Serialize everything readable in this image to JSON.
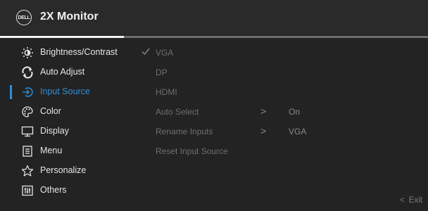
{
  "header": {
    "logo_text": "DELL",
    "title": "2X Monitor"
  },
  "colors": {
    "accent": "#2f8fd8",
    "background": "#232323",
    "header_background": "#2a2a2a",
    "menu_text": "#e6e6e6",
    "disabled_text": "#6f6f6f"
  },
  "menu": {
    "items": [
      {
        "label": "Brightness/Contrast",
        "icon": "brightness-icon"
      },
      {
        "label": "Auto Adjust",
        "icon": "auto-adjust-icon"
      },
      {
        "label": "Input Source",
        "icon": "input-source-icon",
        "selected": true
      },
      {
        "label": "Color",
        "icon": "color-palette-icon"
      },
      {
        "label": "Display",
        "icon": "display-icon"
      },
      {
        "label": "Menu",
        "icon": "menu-icon"
      },
      {
        "label": "Personalize",
        "icon": "star-icon"
      },
      {
        "label": "Others",
        "icon": "others-icon"
      }
    ]
  },
  "submenu": {
    "items": [
      {
        "label": "VGA",
        "checked": true
      },
      {
        "label": "DP"
      },
      {
        "label": "HDMI"
      },
      {
        "label": "Auto Select",
        "arrow": ">",
        "value": "On"
      },
      {
        "label": "Rename Inputs",
        "arrow": ">",
        "value": "VGA"
      },
      {
        "label": "Reset Input Source"
      }
    ]
  },
  "footer": {
    "exit_chevron": "<",
    "exit_label": "Exit"
  }
}
